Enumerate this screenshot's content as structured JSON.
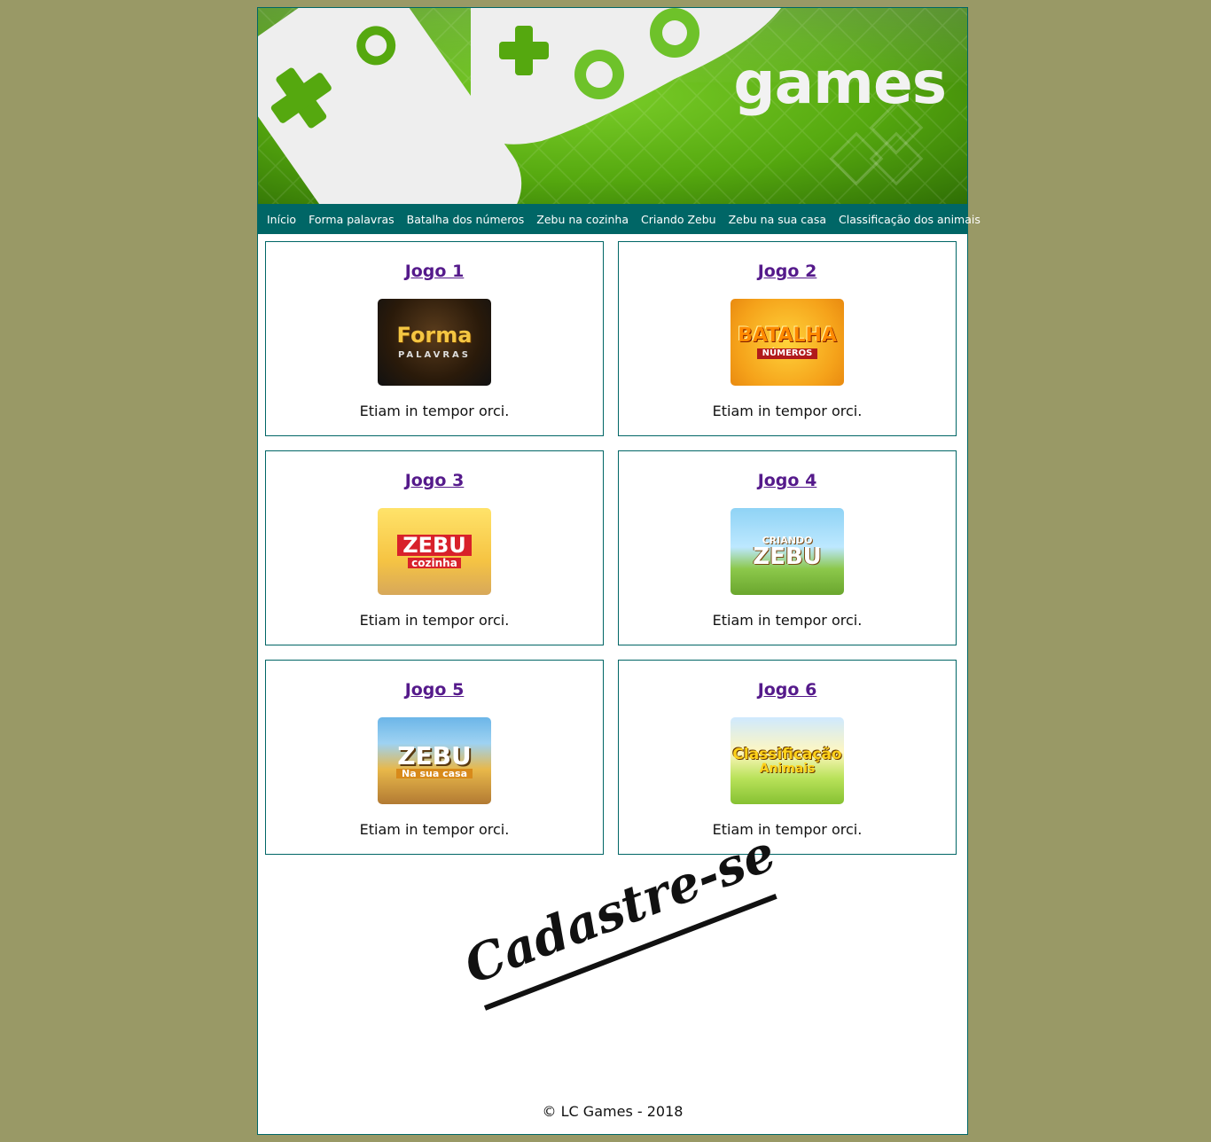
{
  "banner": {
    "wordmark": "games"
  },
  "nav": {
    "items": [
      "Início",
      "Forma palavras",
      "Batalha dos números",
      "Zebu na cozinha",
      "Criando Zebu",
      "Zebu na sua casa",
      "Classificação dos animais"
    ]
  },
  "cards": [
    {
      "title": "Jogo 1",
      "thumb_big": "Forma",
      "thumb_small": "PALAVRAS",
      "desc": "Etiam in tempor orci."
    },
    {
      "title": "Jogo 2",
      "thumb_big": "BATALHA",
      "thumb_small": "NÚMEROS",
      "desc": "Etiam in tempor orci."
    },
    {
      "title": "Jogo 3",
      "thumb_big": "ZEBU",
      "thumb_small": "cozinha",
      "desc": "Etiam in tempor orci."
    },
    {
      "title": "Jogo 4",
      "thumb_big": "ZEBU",
      "thumb_small": "CRIANDO",
      "desc": "Etiam in tempor orci."
    },
    {
      "title": "Jogo 5",
      "thumb_big": "ZEBU",
      "thumb_small": "Na sua casa",
      "desc": "Etiam in tempor orci."
    },
    {
      "title": "Jogo 6",
      "thumb_big": "Classificação",
      "thumb_small": "Animais",
      "desc": "Etiam in tempor orci."
    }
  ],
  "signup": {
    "label": "Cadastre-se"
  },
  "footer": {
    "text": "© LC Games - 2018"
  },
  "colors": {
    "background": "#999966",
    "nav": "#006666",
    "link": "#551a8b",
    "banner_green": "#55a80f"
  }
}
